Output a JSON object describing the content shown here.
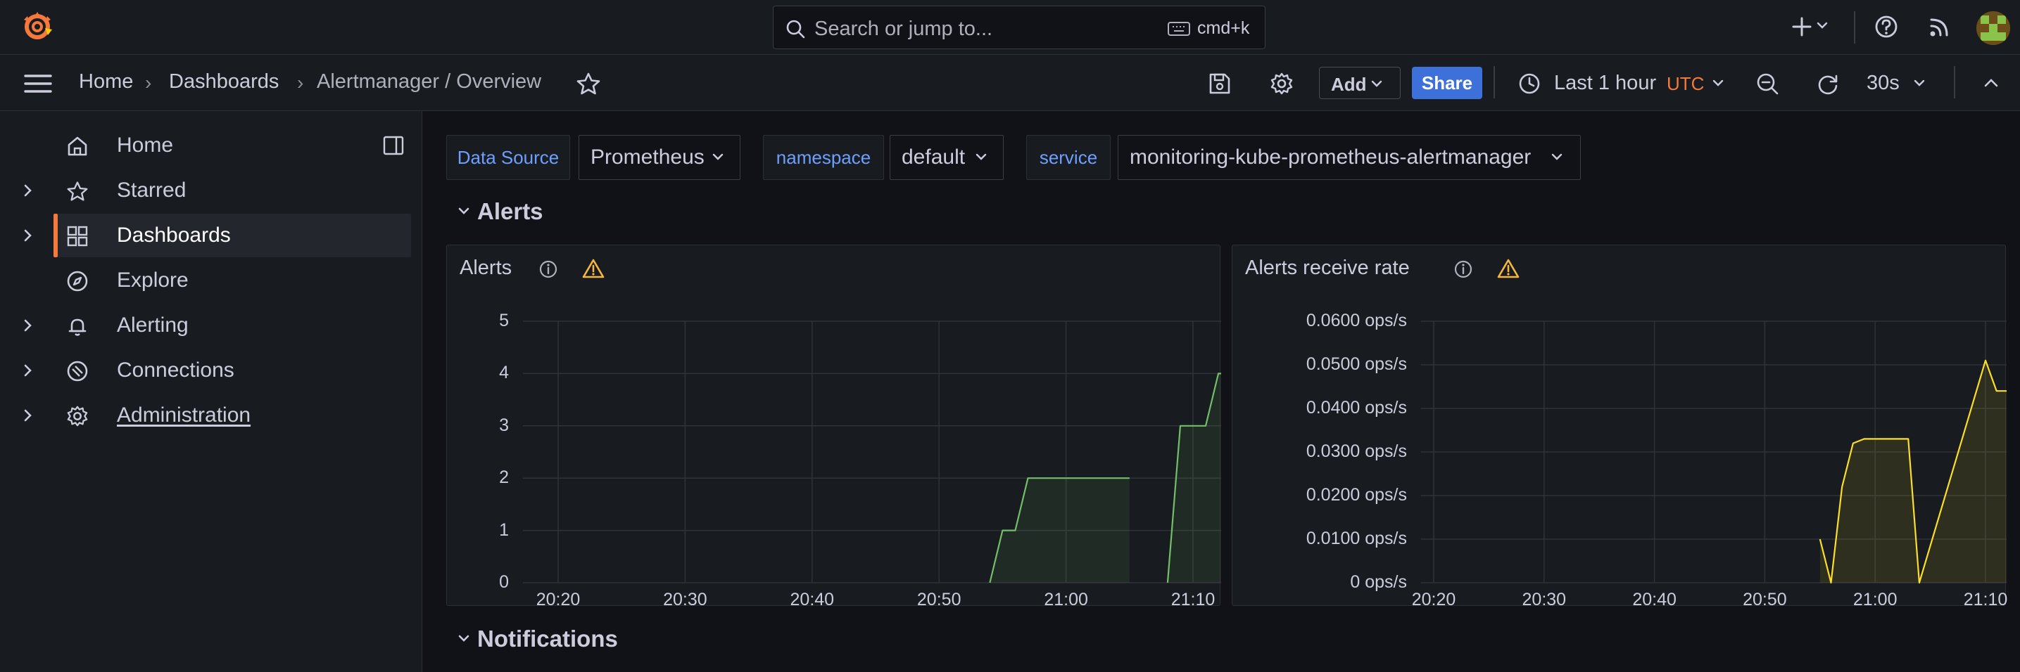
{
  "topbar": {
    "search_placeholder": "Search or jump to...",
    "search_shortcut": "cmd+k",
    "icons": [
      "grafana-logo",
      "search-icon",
      "keyboard-icon",
      "plus-icon",
      "chevron-down-icon",
      "help-icon",
      "news-rss-icon",
      "avatar"
    ]
  },
  "breadcrumbs": [
    "Home",
    "Dashboards",
    "Alertmanager / Overview"
  ],
  "toolbar": {
    "add_label": "Add",
    "share_label": "Share",
    "time_range": "Last 1 hour",
    "timezone": "UTC",
    "refresh_interval": "30s"
  },
  "sidebar": {
    "items": [
      {
        "label": "Home",
        "icon": "home-icon",
        "expandable": false,
        "active": false
      },
      {
        "label": "Starred",
        "icon": "star-icon",
        "expandable": true,
        "active": false
      },
      {
        "label": "Dashboards",
        "icon": "apps-icon",
        "expandable": true,
        "active": true
      },
      {
        "label": "Explore",
        "icon": "compass-icon",
        "expandable": false,
        "active": false
      },
      {
        "label": "Alerting",
        "icon": "bell-icon",
        "expandable": true,
        "active": false
      },
      {
        "label": "Connections",
        "icon": "connections-icon",
        "expandable": true,
        "active": false
      },
      {
        "label": "Administration",
        "icon": "cog-icon",
        "expandable": true,
        "active": false
      }
    ]
  },
  "variables": [
    {
      "label": "Data Source",
      "value": "Prometheus"
    },
    {
      "label": "namespace",
      "value": "default"
    },
    {
      "label": "service",
      "value": "monitoring-kube-prometheus-alertmanager"
    }
  ],
  "rows": {
    "alerts": "Alerts",
    "notifications": "Notifications"
  },
  "colors": {
    "accent": "#f5793a",
    "link": "#6e9fff",
    "share": "#3d71d9",
    "series_green": "#73bf69",
    "series_yellow": "#fade2a",
    "warning": "#f5b73d"
  },
  "chart_data": [
    {
      "type": "area",
      "title": "Alerts",
      "x_tick_labels": [
        "20:20",
        "20:30",
        "20:40",
        "20:50",
        "21:00",
        "21:10"
      ],
      "y_tick_labels": [
        "0",
        "1",
        "2",
        "3",
        "4",
        "5"
      ],
      "ylim": [
        0,
        5
      ],
      "x": [
        "20:54",
        "20:55",
        "20:56",
        "20:57",
        "20:58",
        "21:05",
        "21:07",
        "21:08",
        "21:09",
        "21:10",
        "21:11",
        "21:12",
        "21:13",
        "21:14"
      ],
      "series": [
        {
          "color": "#73bf69",
          "values": [
            0,
            1,
            1,
            2,
            2,
            2,
            null,
            0,
            3,
            3,
            3,
            4,
            4,
            null
          ]
        }
      ],
      "grid": true
    },
    {
      "type": "area",
      "title": "Alerts receive rate",
      "x_tick_labels": [
        "20:20",
        "20:30",
        "20:40",
        "20:50",
        "21:00",
        "21:10"
      ],
      "y_tick_labels": [
        "0 ops/s",
        "0.0100 ops/s",
        "0.0200 ops/s",
        "0.0300 ops/s",
        "0.0400 ops/s",
        "0.0500 ops/s",
        "0.0600 ops/s"
      ],
      "ylim": [
        0,
        0.06
      ],
      "x": [
        "20:55",
        "20:56",
        "20:57",
        "20:58",
        "20:59",
        "21:00",
        "21:01",
        "21:02",
        "21:03",
        "21:04",
        "21:10",
        "21:11",
        "21:12",
        "21:13",
        "21:14"
      ],
      "series": [
        {
          "color": "#fade2a",
          "values": [
            0.01,
            0,
            0.022,
            0.032,
            0.033,
            0.033,
            0.033,
            0.033,
            0.033,
            0,
            0.051,
            0.044,
            0.044,
            0.055,
            0.044
          ]
        }
      ],
      "grid": true
    }
  ]
}
